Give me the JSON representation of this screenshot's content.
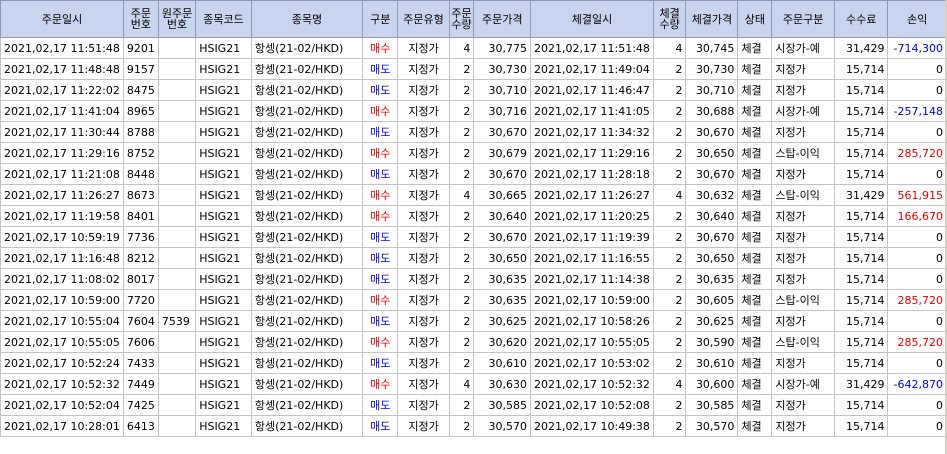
{
  "colors": {
    "header_bg": "#c9d4ee",
    "buy": "#e60000",
    "sell": "#0000d0",
    "profit": "#e60000",
    "loss": "#0000d0"
  },
  "columns": [
    {
      "key": "order_time",
      "label": "주문일시"
    },
    {
      "key": "order_no",
      "label": "주문\n번호"
    },
    {
      "key": "orig_order_no",
      "label": "원주문\n번호"
    },
    {
      "key": "code",
      "label": "종목코드"
    },
    {
      "key": "name",
      "label": "종목명"
    },
    {
      "key": "side",
      "label": "구분"
    },
    {
      "key": "order_type",
      "label": "주문유형"
    },
    {
      "key": "order_qty",
      "label": "주문\n수량"
    },
    {
      "key": "order_price",
      "label": "주문가격"
    },
    {
      "key": "fill_time",
      "label": "체결일시"
    },
    {
      "key": "fill_qty",
      "label": "체결\n수량"
    },
    {
      "key": "fill_price",
      "label": "체결가격"
    },
    {
      "key": "status",
      "label": "상태"
    },
    {
      "key": "order_class",
      "label": "주문구분"
    },
    {
      "key": "fee",
      "label": "수수료"
    },
    {
      "key": "pnl",
      "label": "손익"
    }
  ],
  "rows": [
    {
      "order_time": "2021,02,17 11:51:48",
      "order_no": "9201",
      "orig_order_no": "",
      "code": "HSIG21",
      "name": "항셍(21-02/HKD)",
      "side": "매수",
      "order_type": "지정가",
      "order_qty": "4",
      "order_price": "30,775",
      "fill_time": "2021,02,17 11:51:48",
      "fill_qty": "4",
      "fill_price": "30,745",
      "status": "체결",
      "order_class": "시장가-예",
      "fee": "31,429",
      "pnl": "-714,300"
    },
    {
      "order_time": "2021,02,17 11:48:48",
      "order_no": "9157",
      "orig_order_no": "",
      "code": "HSIG21",
      "name": "항셍(21-02/HKD)",
      "side": "매도",
      "order_type": "지정가",
      "order_qty": "2",
      "order_price": "30,730",
      "fill_time": "2021,02,17 11:49:04",
      "fill_qty": "2",
      "fill_price": "30,730",
      "status": "체결",
      "order_class": "지정가",
      "fee": "15,714",
      "pnl": "0"
    },
    {
      "order_time": "2021,02,17 11:22:02",
      "order_no": "8475",
      "orig_order_no": "",
      "code": "HSIG21",
      "name": "항셍(21-02/HKD)",
      "side": "매도",
      "order_type": "지정가",
      "order_qty": "2",
      "order_price": "30,710",
      "fill_time": "2021,02,17 11:46:47",
      "fill_qty": "2",
      "fill_price": "30,710",
      "status": "체결",
      "order_class": "지정가",
      "fee": "15,714",
      "pnl": "0"
    },
    {
      "order_time": "2021,02,17 11:41:04",
      "order_no": "8965",
      "orig_order_no": "",
      "code": "HSIG21",
      "name": "항셍(21-02/HKD)",
      "side": "매수",
      "order_type": "지정가",
      "order_qty": "2",
      "order_price": "30,716",
      "fill_time": "2021,02,17 11:41:05",
      "fill_qty": "2",
      "fill_price": "30,688",
      "status": "체결",
      "order_class": "시장가-예",
      "fee": "15,714",
      "pnl": "-257,148"
    },
    {
      "order_time": "2021,02,17 11:30:44",
      "order_no": "8788",
      "orig_order_no": "",
      "code": "HSIG21",
      "name": "항셍(21-02/HKD)",
      "side": "매도",
      "order_type": "지정가",
      "order_qty": "2",
      "order_price": "30,670",
      "fill_time": "2021,02,17 11:34:32",
      "fill_qty": "2",
      "fill_price": "30,670",
      "status": "체결",
      "order_class": "지정가",
      "fee": "15,714",
      "pnl": "0"
    },
    {
      "order_time": "2021,02,17 11:29:16",
      "order_no": "8752",
      "orig_order_no": "",
      "code": "HSIG21",
      "name": "항셍(21-02/HKD)",
      "side": "매수",
      "order_type": "지정가",
      "order_qty": "2",
      "order_price": "30,679",
      "fill_time": "2021,02,17 11:29:16",
      "fill_qty": "2",
      "fill_price": "30,650",
      "status": "체결",
      "order_class": "스탑-이익",
      "fee": "15,714",
      "pnl": "285,720"
    },
    {
      "order_time": "2021,02,17 11:21:08",
      "order_no": "8448",
      "orig_order_no": "",
      "code": "HSIG21",
      "name": "항셍(21-02/HKD)",
      "side": "매도",
      "order_type": "지정가",
      "order_qty": "2",
      "order_price": "30,670",
      "fill_time": "2021,02,17 11:28:18",
      "fill_qty": "2",
      "fill_price": "30,670",
      "status": "체결",
      "order_class": "지정가",
      "fee": "15,714",
      "pnl": "0"
    },
    {
      "order_time": "2021,02,17 11:26:27",
      "order_no": "8673",
      "orig_order_no": "",
      "code": "HSIG21",
      "name": "항셍(21-02/HKD)",
      "side": "매수",
      "order_type": "지정가",
      "order_qty": "4",
      "order_price": "30,665",
      "fill_time": "2021,02,17 11:26:27",
      "fill_qty": "4",
      "fill_price": "30,632",
      "status": "체결",
      "order_class": "스탑-이익",
      "fee": "31,429",
      "pnl": "561,915"
    },
    {
      "order_time": "2021,02,17 11:19:58",
      "order_no": "8401",
      "orig_order_no": "",
      "code": "HSIG21",
      "name": "항셍(21-02/HKD)",
      "side": "매수",
      "order_type": "지정가",
      "order_qty": "2",
      "order_price": "30,640",
      "fill_time": "2021,02,17 11:20:25",
      "fill_qty": "2",
      "fill_price": "30,640",
      "status": "체결",
      "order_class": "지정가",
      "fee": "15,714",
      "pnl": "166,670"
    },
    {
      "order_time": "2021,02,17 10:59:19",
      "order_no": "7736",
      "orig_order_no": "",
      "code": "HSIG21",
      "name": "항셍(21-02/HKD)",
      "side": "매도",
      "order_type": "지정가",
      "order_qty": "2",
      "order_price": "30,670",
      "fill_time": "2021,02,17 11:19:39",
      "fill_qty": "2",
      "fill_price": "30,670",
      "status": "체결",
      "order_class": "지정가",
      "fee": "15,714",
      "pnl": "0"
    },
    {
      "order_time": "2021,02,17 11:16:48",
      "order_no": "8212",
      "orig_order_no": "",
      "code": "HSIG21",
      "name": "항셍(21-02/HKD)",
      "side": "매도",
      "order_type": "지정가",
      "order_qty": "2",
      "order_price": "30,650",
      "fill_time": "2021,02,17 11:16:55",
      "fill_qty": "2",
      "fill_price": "30,650",
      "status": "체결",
      "order_class": "지정가",
      "fee": "15,714",
      "pnl": "0"
    },
    {
      "order_time": "2021,02,17 11:08:02",
      "order_no": "8017",
      "orig_order_no": "",
      "code": "HSIG21",
      "name": "항셍(21-02/HKD)",
      "side": "매도",
      "order_type": "지정가",
      "order_qty": "2",
      "order_price": "30,635",
      "fill_time": "2021,02,17 11:14:38",
      "fill_qty": "2",
      "fill_price": "30,635",
      "status": "체결",
      "order_class": "지정가",
      "fee": "15,714",
      "pnl": "0"
    },
    {
      "order_time": "2021,02,17 10:59:00",
      "order_no": "7720",
      "orig_order_no": "",
      "code": "HSIG21",
      "name": "항셍(21-02/HKD)",
      "side": "매수",
      "order_type": "지정가",
      "order_qty": "2",
      "order_price": "30,635",
      "fill_time": "2021,02,17 10:59:00",
      "fill_qty": "2",
      "fill_price": "30,605",
      "status": "체결",
      "order_class": "스탑-이익",
      "fee": "15,714",
      "pnl": "285,720"
    },
    {
      "order_time": "2021,02,17 10:55:04",
      "order_no": "7604",
      "orig_order_no": "7539",
      "code": "HSIG21",
      "name": "항셍(21-02/HKD)",
      "side": "매도",
      "order_type": "지정가",
      "order_qty": "2",
      "order_price": "30,625",
      "fill_time": "2021,02,17 10:58:26",
      "fill_qty": "2",
      "fill_price": "30,625",
      "status": "체결",
      "order_class": "지정가",
      "fee": "15,714",
      "pnl": "0"
    },
    {
      "order_time": "2021,02,17 10:55:05",
      "order_no": "7606",
      "orig_order_no": "",
      "code": "HSIG21",
      "name": "항셍(21-02/HKD)",
      "side": "매수",
      "order_type": "지정가",
      "order_qty": "2",
      "order_price": "30,620",
      "fill_time": "2021,02,17 10:55:05",
      "fill_qty": "2",
      "fill_price": "30,590",
      "status": "체결",
      "order_class": "스탑-이익",
      "fee": "15,714",
      "pnl": "285,720"
    },
    {
      "order_time": "2021,02,17 10:52:24",
      "order_no": "7433",
      "orig_order_no": "",
      "code": "HSIG21",
      "name": "항셍(21-02/HKD)",
      "side": "매도",
      "order_type": "지정가",
      "order_qty": "2",
      "order_price": "30,610",
      "fill_time": "2021,02,17 10:53:02",
      "fill_qty": "2",
      "fill_price": "30,610",
      "status": "체결",
      "order_class": "지정가",
      "fee": "15,714",
      "pnl": "0"
    },
    {
      "order_time": "2021,02,17 10:52:32",
      "order_no": "7449",
      "orig_order_no": "",
      "code": "HSIG21",
      "name": "항셍(21-02/HKD)",
      "side": "매수",
      "order_type": "지정가",
      "order_qty": "4",
      "order_price": "30,630",
      "fill_time": "2021,02,17 10:52:32",
      "fill_qty": "4",
      "fill_price": "30,600",
      "status": "체결",
      "order_class": "시장가-예",
      "fee": "31,429",
      "pnl": "-642,870"
    },
    {
      "order_time": "2021,02,17 10:52:04",
      "order_no": "7425",
      "orig_order_no": "",
      "code": "HSIG21",
      "name": "항셍(21-02/HKD)",
      "side": "매도",
      "order_type": "지정가",
      "order_qty": "2",
      "order_price": "30,585",
      "fill_time": "2021,02,17 10:52:08",
      "fill_qty": "2",
      "fill_price": "30,585",
      "status": "체결",
      "order_class": "지정가",
      "fee": "15,714",
      "pnl": "0"
    },
    {
      "order_time": "2021,02,17 10:28:01",
      "order_no": "6413",
      "orig_order_no": "",
      "code": "HSIG21",
      "name": "항셍(21-02/HKD)",
      "side": "매도",
      "order_type": "지정가",
      "order_qty": "2",
      "order_price": "30,570",
      "fill_time": "2021,02,17 10:49:38",
      "fill_qty": "2",
      "fill_price": "30,570",
      "status": "체결",
      "order_class": "지정가",
      "fee": "15,714",
      "pnl": "0"
    }
  ]
}
